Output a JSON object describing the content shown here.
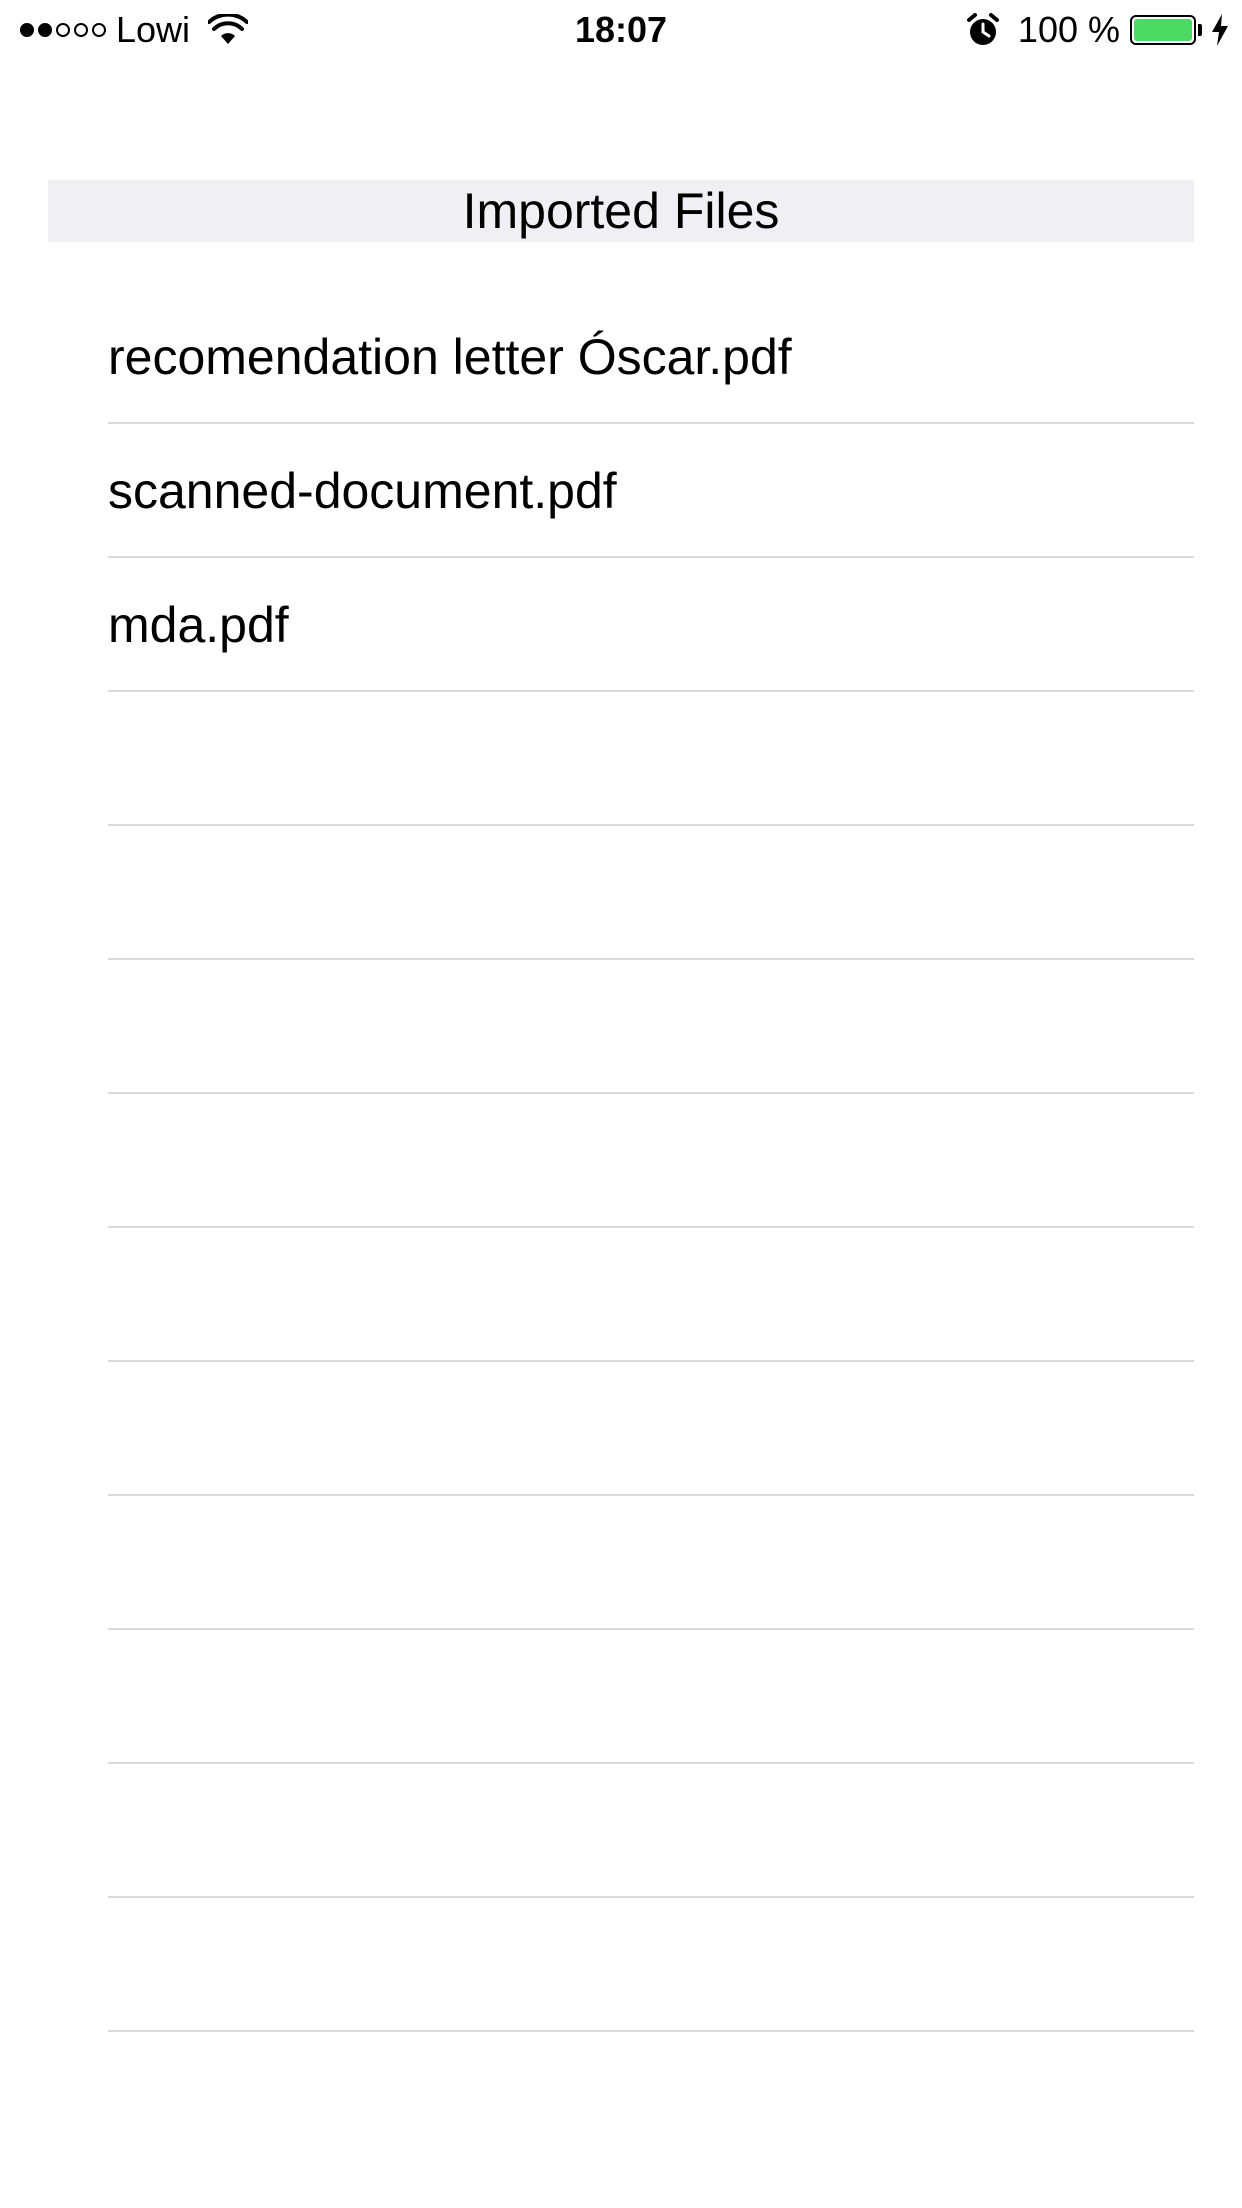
{
  "status_bar": {
    "signal": {
      "filled": 2,
      "total": 5
    },
    "carrier": "Lowi",
    "time": "18:07",
    "battery_percent": "100 %",
    "battery_level": 1.0,
    "battery_color": "#4cd964",
    "icons": [
      "wifi-icon",
      "alarm-icon",
      "battery-icon",
      "charging-bolt-icon"
    ]
  },
  "section": {
    "title": "Imported Files",
    "background": "#efeff4"
  },
  "files": [
    {
      "name": "recomendation letter Óscar.pdf"
    },
    {
      "name": "scanned-document.pdf"
    },
    {
      "name": "mda.pdf"
    },
    {
      "name": ""
    },
    {
      "name": ""
    },
    {
      "name": ""
    },
    {
      "name": ""
    },
    {
      "name": ""
    },
    {
      "name": ""
    },
    {
      "name": ""
    },
    {
      "name": ""
    },
    {
      "name": ""
    },
    {
      "name": ""
    }
  ]
}
